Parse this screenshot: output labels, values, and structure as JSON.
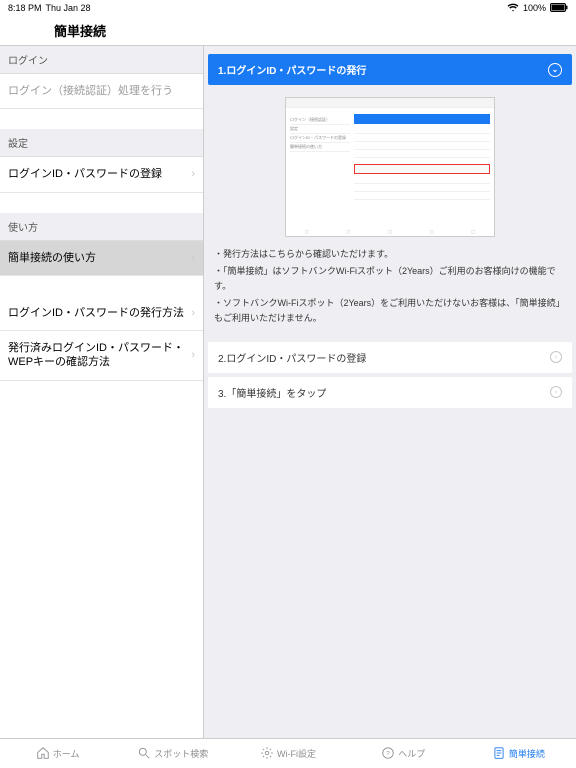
{
  "status": {
    "time": "8:18 PM",
    "date": "Thu Jan 28",
    "battery": "100%"
  },
  "nav": {
    "title": "簡単接続"
  },
  "sidebar": {
    "sections": [
      {
        "header": "ログイン",
        "items": [
          {
            "label": "ログイン（接続認証）処理を行う",
            "dim": true,
            "chev": false
          }
        ]
      },
      {
        "header": "設定",
        "items": [
          {
            "label": "ログインID・パスワードの登録",
            "dim": false,
            "chev": true
          }
        ]
      },
      {
        "header": "使い方",
        "items": [
          {
            "label": "簡単接続の使い方",
            "dim": false,
            "chev": true,
            "selected": true
          },
          {
            "label": "ログインID・パスワードの発行方法",
            "dim": false,
            "chev": true,
            "spacerBefore": true
          },
          {
            "label": "発行済みログインID・パスワード・WEPキーの確認方法",
            "dim": false,
            "chev": true
          }
        ]
      }
    ]
  },
  "detail": {
    "step1_title": "1.ログインID・パスワードの発行",
    "bullets": [
      "・発行方法はこちらから確認いただけます。",
      "・「簡単接続」はソフトバンクWi-Fiスポット（2Years）ご利用のお客様向けの機能です。",
      "・ソフトバンクWi-Fiスポット（2Years）をご利用いただけないお客様は、「簡単接続」もご利用いただけません。"
    ],
    "step2_title": "2.ログインID・パスワードの登録",
    "step3_title": "3.「簡単接続」をタップ"
  },
  "tabs": {
    "home": "ホーム",
    "search": "スポット検索",
    "wifi": "Wi-Fi設定",
    "help": "ヘルプ",
    "easy": "簡単接続"
  }
}
